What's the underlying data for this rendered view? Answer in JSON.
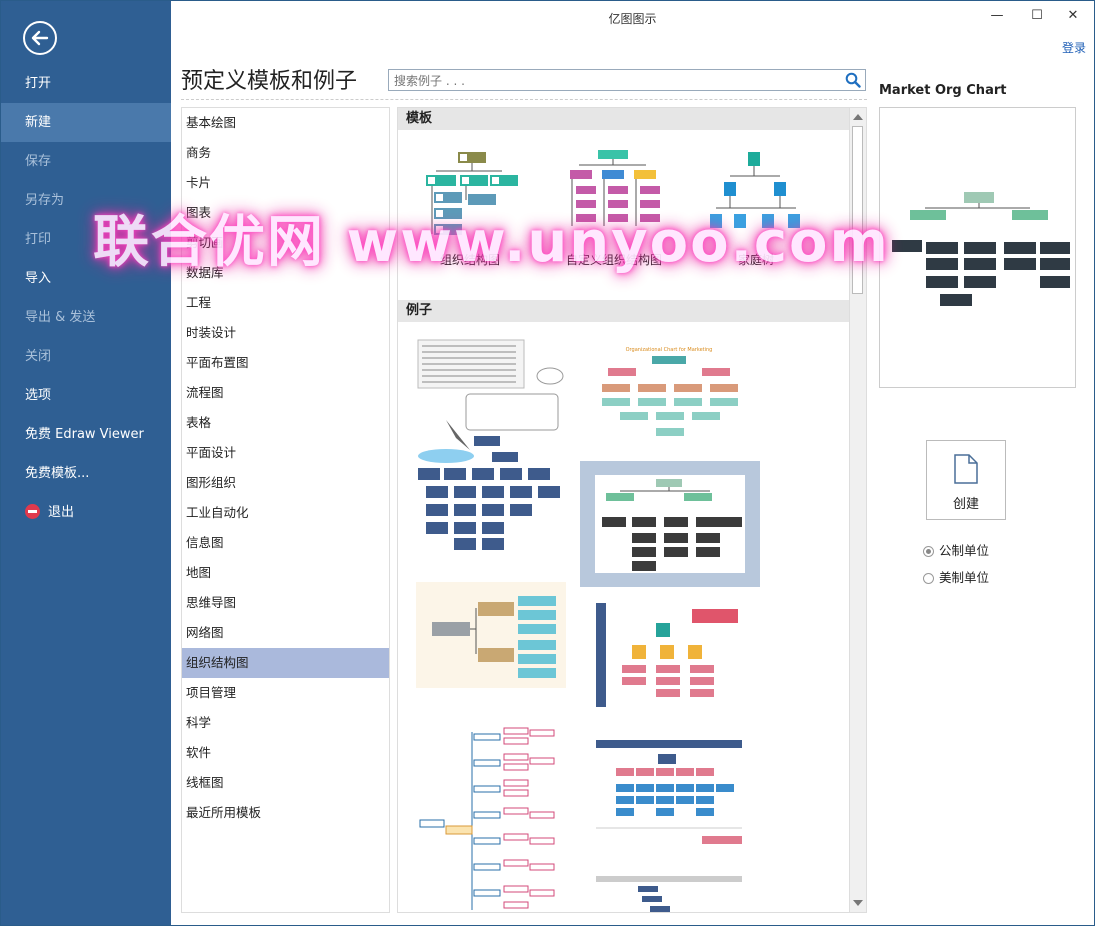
{
  "window": {
    "title": "亿图图示",
    "minimize": "—",
    "maximize": "☐",
    "close": "✕",
    "login": "登录"
  },
  "sidebar": {
    "items": [
      {
        "label": "打开",
        "state": "normal"
      },
      {
        "label": "新建",
        "state": "active"
      },
      {
        "label": "保存",
        "state": "disabled"
      },
      {
        "label": "另存为",
        "state": "disabled"
      },
      {
        "label": "打印",
        "state": "disabled"
      },
      {
        "label": "导入",
        "state": "normal"
      },
      {
        "label": "导出 & 发送",
        "state": "disabled"
      },
      {
        "label": "关闭",
        "state": "disabled"
      },
      {
        "label": "选项",
        "state": "normal"
      },
      {
        "label": "免费 Edraw Viewer",
        "state": "normal"
      },
      {
        "label": "免费模板...",
        "state": "normal"
      },
      {
        "label": "退出",
        "state": "normal"
      }
    ]
  },
  "main": {
    "heading": "预定义模板和例子",
    "search_placeholder": "搜索例子 . . .",
    "categories": [
      "基本绘图",
      "商务",
      "卡片",
      "图表",
      "剪切画",
      "数据库",
      "工程",
      "时装设计",
      "平面布置图",
      "流程图",
      "表格",
      "平面设计",
      "图形组织",
      "工业自动化",
      "信息图",
      "地图",
      "思维导图",
      "网络图",
      "组织结构图",
      "项目管理",
      "科学",
      "软件",
      "线框图",
      "最近所用模板"
    ],
    "selected_category": "组织结构图",
    "templates_header": "模板",
    "templates": [
      "组织结构图",
      "自定义组织结构图",
      "家庭树"
    ],
    "examples_header": "例子",
    "example_snippets": {
      "title_small": "Organizational Chart for Marketing"
    }
  },
  "preview": {
    "title": "Market Org Chart",
    "create_label": "创建",
    "units": [
      {
        "label": "公制单位",
        "checked": true
      },
      {
        "label": "美制单位",
        "checked": false
      }
    ]
  },
  "watermark": "联合优网 www.unyoo.com",
  "colors": {
    "sidebar_bg": "#2f5f93",
    "sidebar_active": "#4a79ab",
    "selected_category": "#aab9dc",
    "accent_link": "#1f5fb6"
  }
}
